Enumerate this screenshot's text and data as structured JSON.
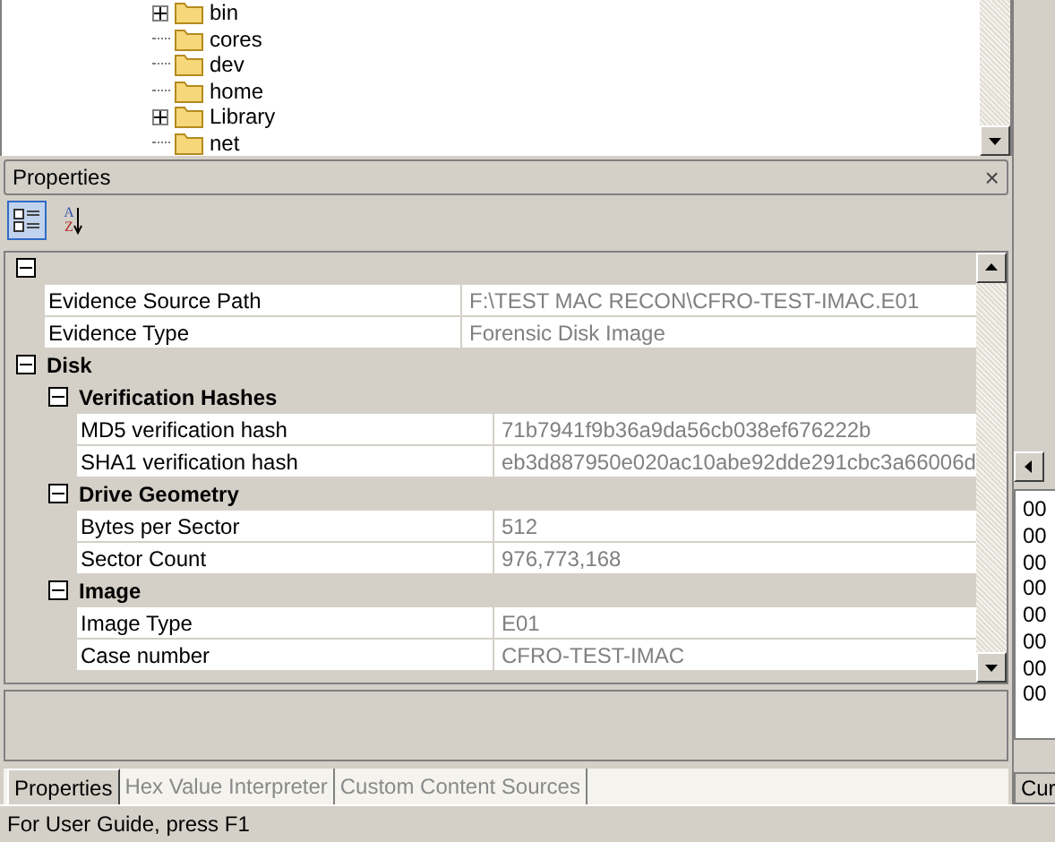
{
  "tree": {
    "items": [
      {
        "label": "bin",
        "expandable": true
      },
      {
        "label": "cores",
        "expandable": false
      },
      {
        "label": "dev",
        "expandable": false
      },
      {
        "label": "home",
        "expandable": false
      },
      {
        "label": "Library",
        "expandable": true
      },
      {
        "label": "net",
        "expandable": false
      }
    ]
  },
  "properties_panel": {
    "title": "Properties",
    "close": "×",
    "toolbar": [
      {
        "kind": "categorized",
        "selected": true
      },
      {
        "kind": "alphabetical",
        "selected": false,
        "glyph_top": "A",
        "glyph_bottom": "Z"
      }
    ],
    "grid": [
      {
        "kind": "category",
        "expanded": true,
        "children": [
          {
            "kind": "property",
            "name": "Evidence Source Path",
            "value": "F:\\TEST MAC RECON\\CFRO-TEST-IMAC.E01"
          },
          {
            "kind": "property",
            "name": "Evidence Type",
            "value": "Forensic Disk Image"
          }
        ]
      },
      {
        "kind": "category",
        "title": "Disk",
        "expanded": true,
        "children": [
          {
            "kind": "category",
            "title": "Verification Hashes",
            "expanded": true,
            "children": [
              {
                "kind": "property",
                "name": "MD5 verification hash",
                "value": "71b7941f9b36a9da56cb038ef676222b"
              },
              {
                "kind": "property",
                "name": "SHA1 verification hash",
                "value": "eb3d887950e020ac10abe92dde291cbc3a66006d"
              }
            ]
          },
          {
            "kind": "category",
            "title": "Drive Geometry",
            "expanded": true,
            "children": [
              {
                "kind": "property",
                "name": "Bytes per Sector",
                "value": "512"
              },
              {
                "kind": "property",
                "name": "Sector Count",
                "value": "976,773,168"
              }
            ]
          },
          {
            "kind": "category",
            "title": "Image",
            "expanded": true,
            "children": [
              {
                "kind": "property",
                "name": "Image Type",
                "value": "E01"
              },
              {
                "kind": "property",
                "name": "Case number",
                "value": "CFRO-TEST-IMAC"
              }
            ]
          }
        ]
      }
    ],
    "tabs": [
      {
        "label": "Properties",
        "selected": true
      },
      {
        "label": "Hex Value Interpreter",
        "selected": false
      },
      {
        "label": "Custom Content Sources",
        "selected": false
      }
    ]
  },
  "hex_view": {
    "rows": [
      "00",
      "00",
      "00",
      "00",
      "00",
      "00",
      "00",
      "00"
    ],
    "tab": "Cur"
  },
  "status_bar": "For User Guide, press F1"
}
